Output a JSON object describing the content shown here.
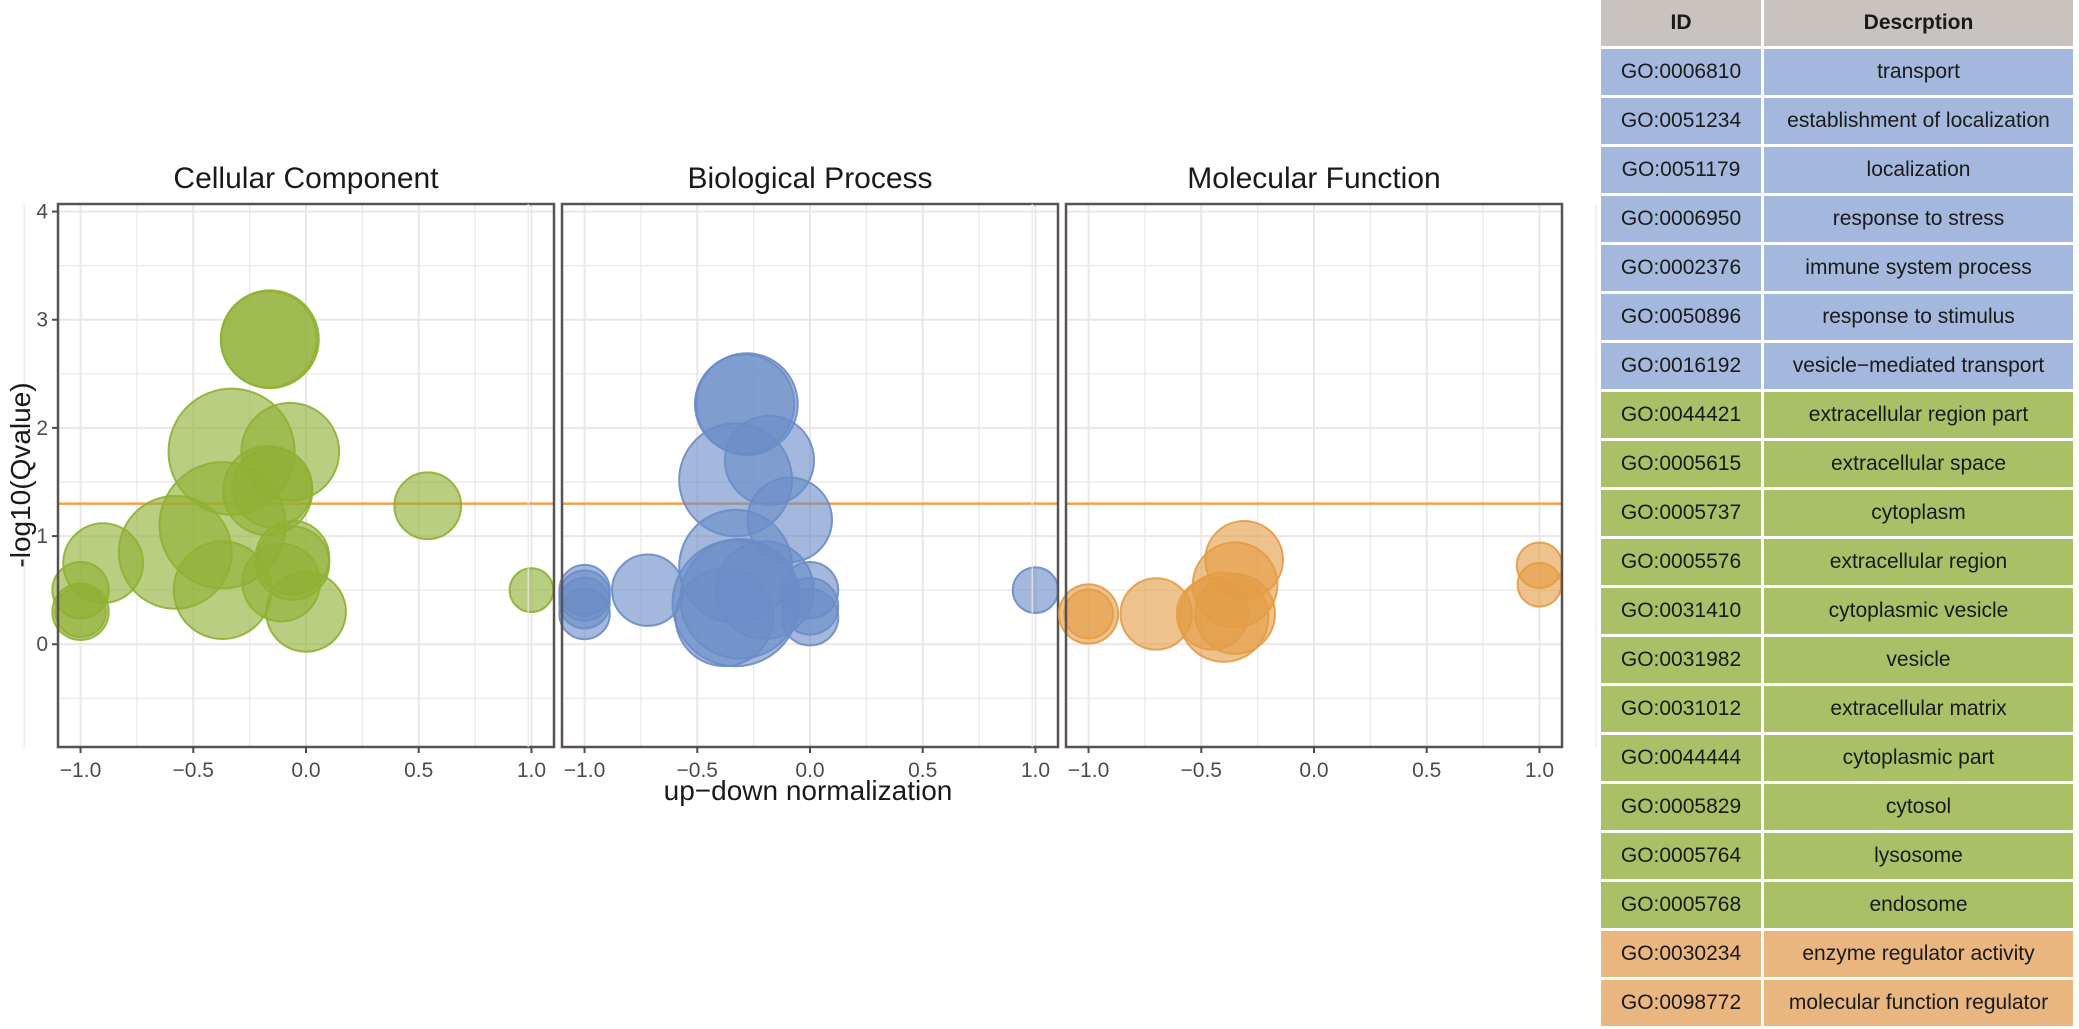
{
  "chart_data": {
    "type": "scatter",
    "subtype": "bubble",
    "xlabel": "up−down normalization",
    "ylabel": "-log10(Qvalue)",
    "xlim": [
      -1.1,
      1.1
    ],
    "ylim": [
      -0.95,
      4.07
    ],
    "xticks": [
      -1.0,
      -0.5,
      0.0,
      0.5,
      1.0
    ],
    "xtick_labels": [
      "−1.0",
      "−0.5",
      "0.0",
      "0.5",
      "1.0"
    ],
    "yticks": [
      0,
      1,
      2,
      3,
      4
    ],
    "ytick_labels": [
      "0",
      "1",
      "2",
      "3",
      "4"
    ],
    "threshold_line": {
      "y": 1.3,
      "color": "#f5a04a"
    },
    "grid": true,
    "panels": [
      {
        "title": "Cellular Component",
        "color": "#8fb034",
        "points": [
          {
            "x": -1.0,
            "y": 0.5,
            "size": 2
          },
          {
            "x": -1.0,
            "y": 0.3,
            "size": 2
          },
          {
            "x": -1.0,
            "y": 0.3,
            "size": 1.6
          },
          {
            "x": -0.9,
            "y": 0.75,
            "size": 4
          },
          {
            "x": -0.58,
            "y": 0.85,
            "size": 8
          },
          {
            "x": -0.33,
            "y": 1.78,
            "size": 10
          },
          {
            "x": -0.37,
            "y": 1.1,
            "size": 10
          },
          {
            "x": -0.37,
            "y": 0.5,
            "size": 6
          },
          {
            "x": -0.16,
            "y": 2.82,
            "size": 6
          },
          {
            "x": -0.165,
            "y": 2.82,
            "size": 5.8
          },
          {
            "x": -0.07,
            "y": 1.78,
            "size": 6
          },
          {
            "x": -0.17,
            "y": 1.42,
            "size": 5
          },
          {
            "x": -0.15,
            "y": 1.45,
            "size": 4
          },
          {
            "x": -0.06,
            "y": 0.8,
            "size": 3.4
          },
          {
            "x": -0.06,
            "y": 0.75,
            "size": 3.4
          },
          {
            "x": -0.11,
            "y": 0.57,
            "size": 3.8
          },
          {
            "x": 0.0,
            "y": 0.3,
            "size": 4
          },
          {
            "x": 0.54,
            "y": 1.28,
            "size": 2.8
          },
          {
            "x": 1.0,
            "y": 0.5,
            "size": 1.2
          }
        ]
      },
      {
        "title": "Biological Process",
        "color": "#6a8cc6",
        "points": [
          {
            "x": -1.0,
            "y": 0.5,
            "size": 1.6
          },
          {
            "x": -1.0,
            "y": 0.45,
            "size": 1.6
          },
          {
            "x": -1.0,
            "y": 0.38,
            "size": 1.6
          },
          {
            "x": -1.0,
            "y": 0.28,
            "size": 1.6
          },
          {
            "x": -0.72,
            "y": 0.5,
            "size": 3.2
          },
          {
            "x": -0.28,
            "y": 2.22,
            "size": 6.5
          },
          {
            "x": -0.29,
            "y": 2.22,
            "size": 6.2
          },
          {
            "x": -0.18,
            "y": 1.7,
            "size": 5
          },
          {
            "x": -0.33,
            "y": 1.52,
            "size": 8
          },
          {
            "x": -0.09,
            "y": 1.15,
            "size": 4.5
          },
          {
            "x": -0.33,
            "y": 0.72,
            "size": 8
          },
          {
            "x": -0.2,
            "y": 0.5,
            "size": 6
          },
          {
            "x": -0.38,
            "y": 0.25,
            "size": 6
          },
          {
            "x": -0.33,
            "y": 0.38,
            "size": 10
          },
          {
            "x": -0.31,
            "y": 0.42,
            "size": 9
          },
          {
            "x": 0.0,
            "y": 0.5,
            "size": 2
          },
          {
            "x": 0.0,
            "y": 0.35,
            "size": 2
          },
          {
            "x": 0.0,
            "y": 0.25,
            "size": 2
          },
          {
            "x": 1.0,
            "y": 0.5,
            "size": 1.3
          }
        ]
      },
      {
        "title": "Molecular Function",
        "color": "#e39c45",
        "points": [
          {
            "x": -1.0,
            "y": 0.28,
            "size": 2.2
          },
          {
            "x": -1.0,
            "y": 0.28,
            "size": 1.5
          },
          {
            "x": -0.7,
            "y": 0.28,
            "size": 3.2
          },
          {
            "x": -0.45,
            "y": 0.28,
            "size": 3.2
          },
          {
            "x": -0.4,
            "y": 0.25,
            "size": 5
          },
          {
            "x": -0.35,
            "y": 0.28,
            "size": 4
          },
          {
            "x": -0.35,
            "y": 0.55,
            "size": 4.5
          },
          {
            "x": -0.31,
            "y": 0.78,
            "size": 3.8
          },
          {
            "x": 1.0,
            "y": 0.73,
            "size": 1.3
          },
          {
            "x": 1.0,
            "y": 0.55,
            "size": 1.2
          }
        ]
      }
    ]
  },
  "table": {
    "headers": [
      "ID",
      "Descrption"
    ],
    "category_colors": {
      "BP": "#a3b8dc",
      "CC": "#a9c066",
      "MF": "#e9b680"
    },
    "rows": [
      {
        "id": "GO:0006810",
        "description": "transport",
        "category": "BP"
      },
      {
        "id": "GO:0051234",
        "description": "establishment of localization",
        "category": "BP"
      },
      {
        "id": "GO:0051179",
        "description": "localization",
        "category": "BP"
      },
      {
        "id": "GO:0006950",
        "description": "response to stress",
        "category": "BP"
      },
      {
        "id": "GO:0002376",
        "description": "immune system process",
        "category": "BP"
      },
      {
        "id": "GO:0050896",
        "description": "response to stimulus",
        "category": "BP"
      },
      {
        "id": "GO:0016192",
        "description": "vesicle−mediated transport",
        "category": "BP"
      },
      {
        "id": "GO:0044421",
        "description": "extracellular region part",
        "category": "CC"
      },
      {
        "id": "GO:0005615",
        "description": "extracellular space",
        "category": "CC"
      },
      {
        "id": "GO:0005737",
        "description": "cytoplasm",
        "category": "CC"
      },
      {
        "id": "GO:0005576",
        "description": "extracellular region",
        "category": "CC"
      },
      {
        "id": "GO:0031410",
        "description": "cytoplasmic vesicle",
        "category": "CC"
      },
      {
        "id": "GO:0031982",
        "description": "vesicle",
        "category": "CC"
      },
      {
        "id": "GO:0031012",
        "description": "extracellular matrix",
        "category": "CC"
      },
      {
        "id": "GO:0044444",
        "description": "cytoplasmic part",
        "category": "CC"
      },
      {
        "id": "GO:0005829",
        "description": "cytosol",
        "category": "CC"
      },
      {
        "id": "GO:0005764",
        "description": "lysosome",
        "category": "CC"
      },
      {
        "id": "GO:0005768",
        "description": "endosome",
        "category": "CC"
      },
      {
        "id": "GO:0030234",
        "description": "enzyme regulator activity",
        "category": "MF"
      },
      {
        "id": "GO:0098772",
        "description": "molecular function regulator",
        "category": "MF"
      }
    ]
  }
}
